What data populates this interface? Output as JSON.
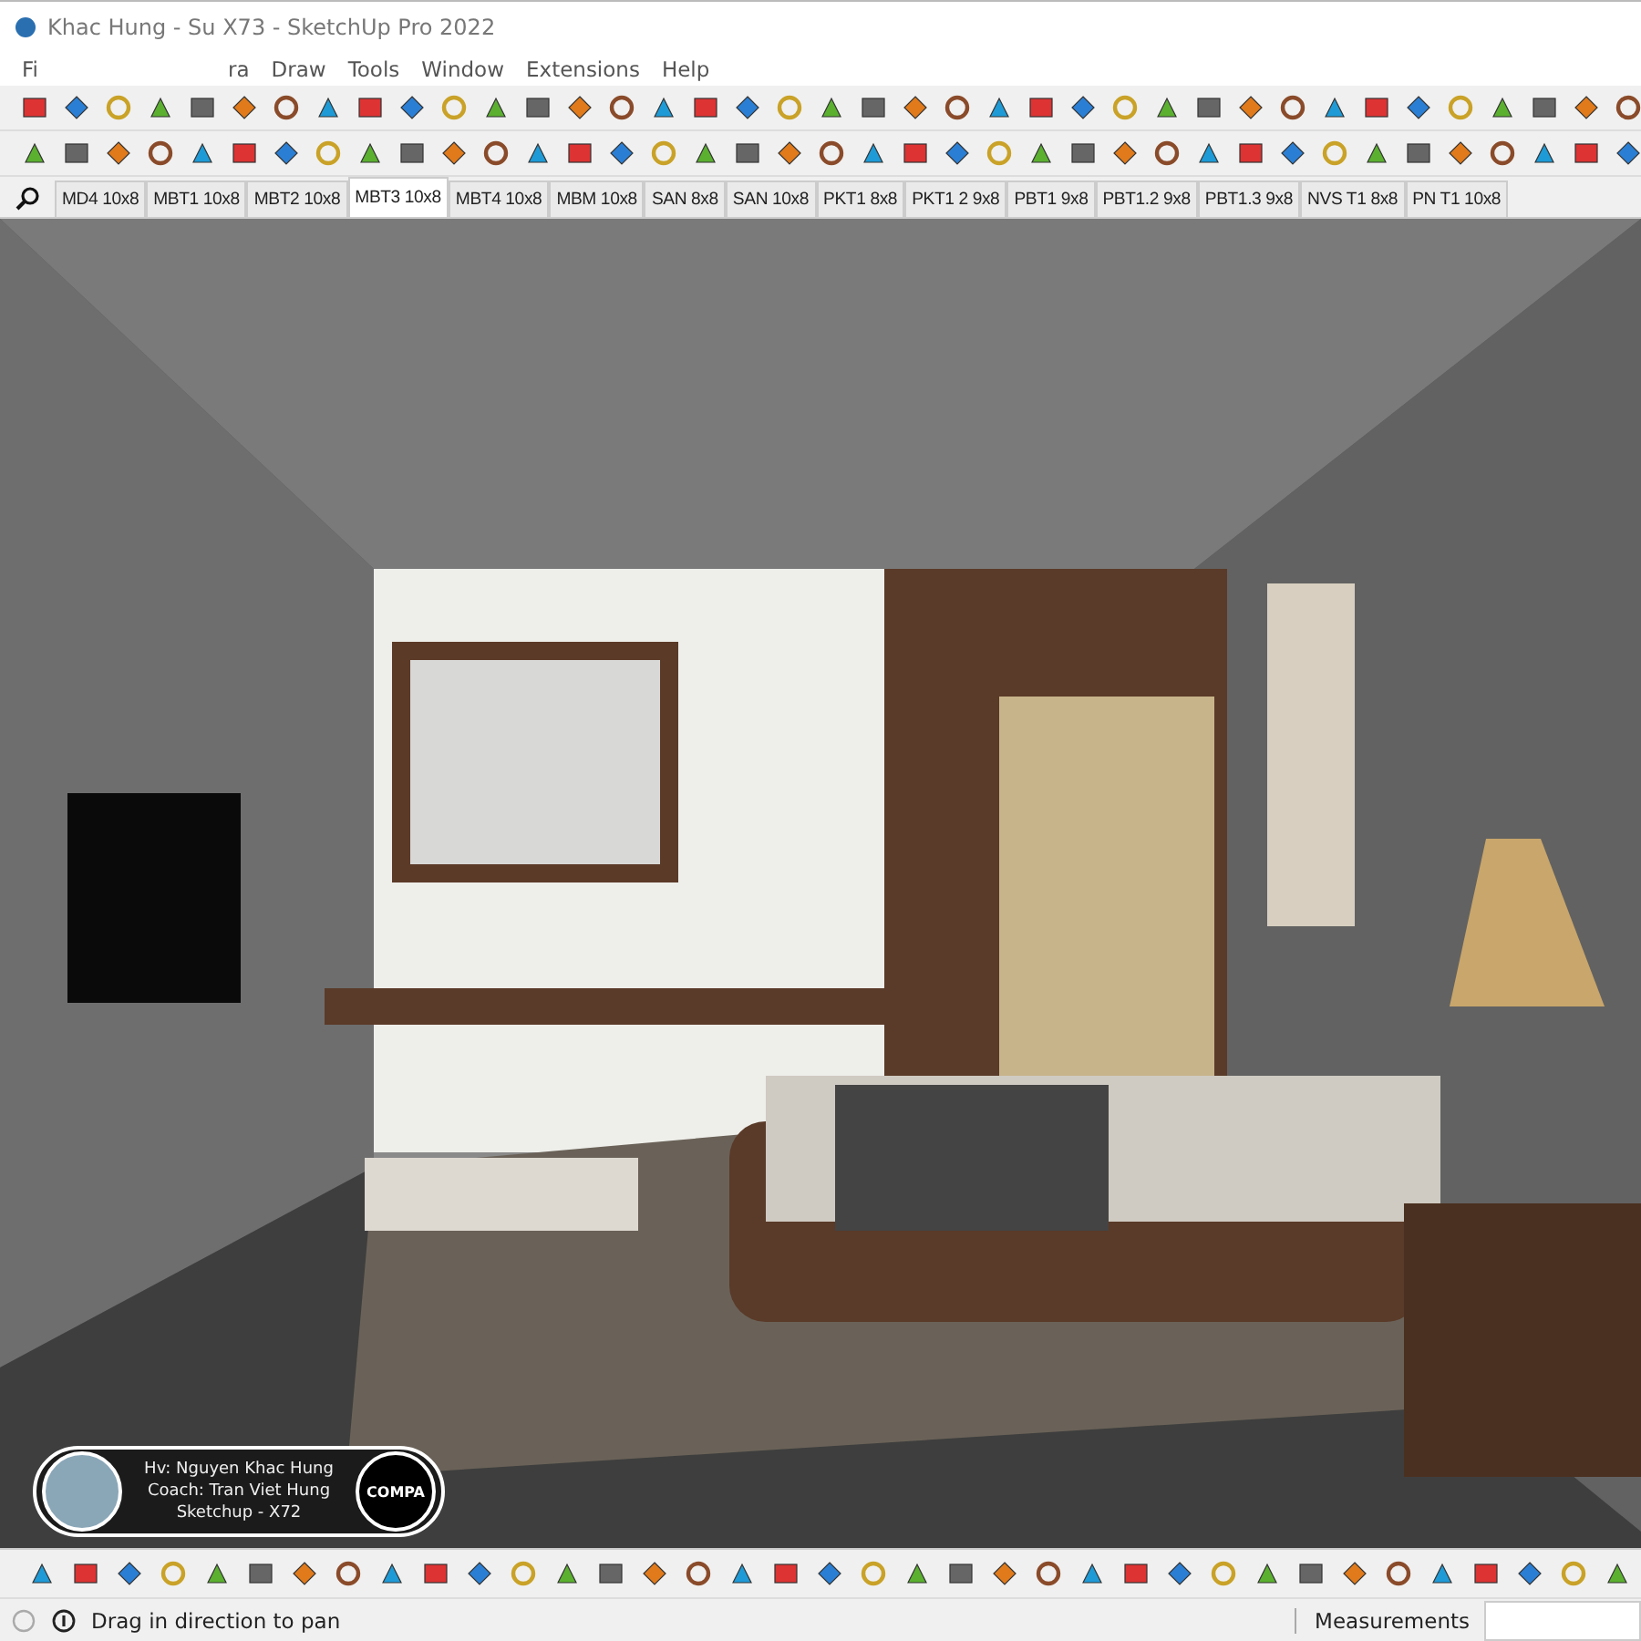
{
  "window": {
    "title": "Khac Hung - Su X73 - SketchUp Pro 2022"
  },
  "menu": [
    {
      "label": "Fi"
    },
    {
      "label": "ra",
      "offset": true
    },
    {
      "label": "Draw"
    },
    {
      "label": "Tools"
    },
    {
      "label": "Window"
    },
    {
      "label": "Extensions"
    },
    {
      "label": "Help"
    }
  ],
  "scene_tabs": [
    {
      "label": "MD4 10x8",
      "selected": false
    },
    {
      "label": "MBT1 10x8",
      "selected": false
    },
    {
      "label": "MBT2 10x8",
      "selected": false
    },
    {
      "label": "MBT3 10x8",
      "selected": true
    },
    {
      "label": "MBT4 10x8",
      "selected": false
    },
    {
      "label": "MBM 10x8",
      "selected": false
    },
    {
      "label": "SAN 8x8",
      "selected": false
    },
    {
      "label": "SAN 10x8",
      "selected": false
    },
    {
      "label": "PKT1 8x8",
      "selected": false
    },
    {
      "label": "PKT1 2 9x8",
      "selected": false
    },
    {
      "label": "PBT1 9x8",
      "selected": false
    },
    {
      "label": "PBT1.2 9x8",
      "selected": false
    },
    {
      "label": "PBT1.3 9x8",
      "selected": false
    },
    {
      "label": "NVS T1 8x8",
      "selected": false
    },
    {
      "label": "PN T1 10x8",
      "selected": false
    }
  ],
  "student_card": {
    "lines": [
      "Hv: Nguyen Khac Hung",
      "Coach: Tran Viet Hung",
      "Sketchup - X72"
    ],
    "logo": "COMPA"
  },
  "status_bar": {
    "hint": "Drag in direction to pan",
    "measurements_label": "Measurements"
  }
}
